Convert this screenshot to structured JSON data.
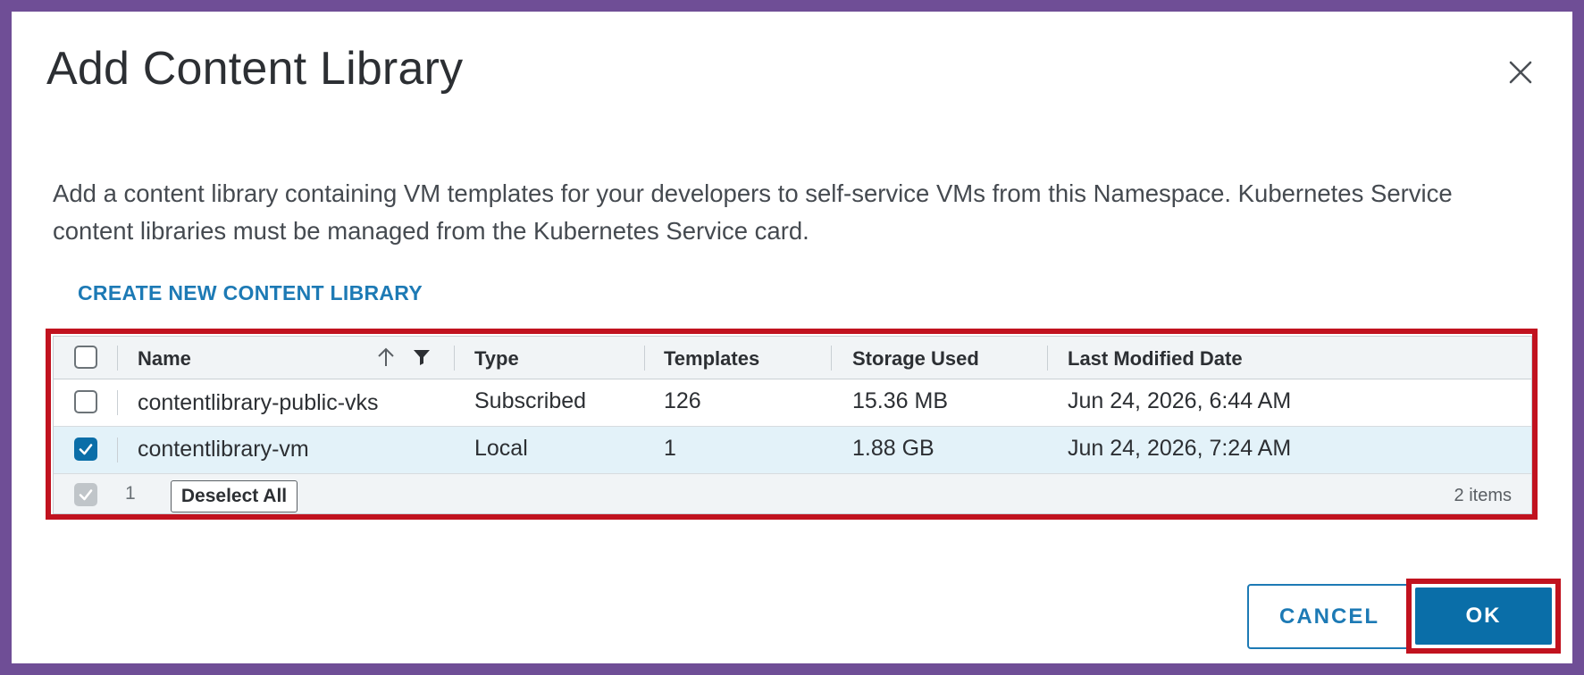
{
  "dialog": {
    "title": "Add Content Library",
    "description": "Add a content library containing VM templates for your developers to self-service VMs from this Namespace. Kubernetes Service content libraries must be managed from the Kubernetes Service card.",
    "create_link": "CREATE NEW CONTENT LIBRARY",
    "close_icon": "close-icon"
  },
  "table": {
    "columns": {
      "name": "Name",
      "type": "Type",
      "templates": "Templates",
      "storage": "Storage Used",
      "modified": "Last Modified Date"
    },
    "sort_icon": "arrow-up-icon",
    "filter_icon": "filter-icon",
    "rows": [
      {
        "name": "contentlibrary-public-vks",
        "type": "Subscribed",
        "templates": "126",
        "storage": "15.36 MB",
        "modified": "Jun 24, 2026, 6:44 AM",
        "selected": false
      },
      {
        "name": "contentlibrary-vm",
        "type": "Local",
        "templates": "1",
        "storage": "1.88 GB",
        "modified": "Jun 24, 2026, 7:24 AM",
        "selected": true
      }
    ],
    "footer": {
      "selected_count": "1",
      "deselect_label": "Deselect All",
      "items_label": "2 items"
    }
  },
  "buttons": {
    "cancel": "CANCEL",
    "ok": "OK"
  },
  "colors": {
    "accent": "#0a6ea8",
    "highlight_border": "#c1121f",
    "frame": "#6f4e96",
    "selected_row": "#e3f2f9"
  }
}
